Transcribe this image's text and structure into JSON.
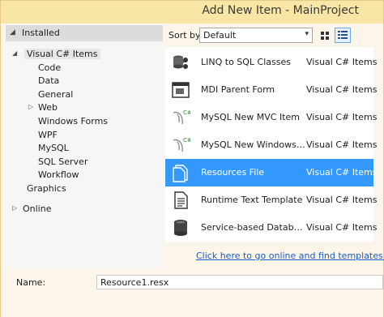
{
  "window": {
    "title": "Add New Item - MainProject"
  },
  "left_panel": {
    "installed_label": "Installed",
    "tree": [
      {
        "label": "Visual C# Items",
        "arrow": "◢",
        "selected": true
      },
      {
        "label": "Code"
      },
      {
        "label": "Data"
      },
      {
        "label": "General"
      },
      {
        "label": "Web",
        "arrow": "▷"
      },
      {
        "label": "Windows Forms"
      },
      {
        "label": "WPF"
      },
      {
        "label": "MySQL"
      },
      {
        "label": "SQL Server"
      },
      {
        "label": "Workflow"
      },
      {
        "label": "Graphics"
      }
    ],
    "online_label": "Online"
  },
  "sortbar": {
    "label": "Sort by:",
    "selected": "Default"
  },
  "items": [
    {
      "name": "LINQ to SQL Classes",
      "category": "Visual C# Items",
      "icon": "linq-icon"
    },
    {
      "name": "MDI Parent Form",
      "category": "Visual C# Items",
      "icon": "mdi-form-icon"
    },
    {
      "name": "MySQL New MVC Item",
      "category": "Visual C# Items",
      "icon": "mysql-dolphin-icon"
    },
    {
      "name": "MySQL New Windows For...",
      "category": "Visual C# Items",
      "icon": "mysql-dolphin-icon"
    },
    {
      "name": "Resources File",
      "category": "Visual C# Items",
      "icon": "resources-file-icon",
      "selected": true
    },
    {
      "name": "Runtime Text Template",
      "category": "Visual C# Items",
      "icon": "text-template-icon"
    },
    {
      "name": "Service-based Database",
      "category": "Visual C# Items",
      "icon": "database-icon"
    }
  ],
  "online_link": "Click here to go online and find templates.",
  "name_field": {
    "label": "Name:",
    "value": "Resource1.resx"
  },
  "colors": {
    "selection": "#3399ff",
    "title_bg": "#f7e6a6",
    "link": "#1a5cc8"
  }
}
